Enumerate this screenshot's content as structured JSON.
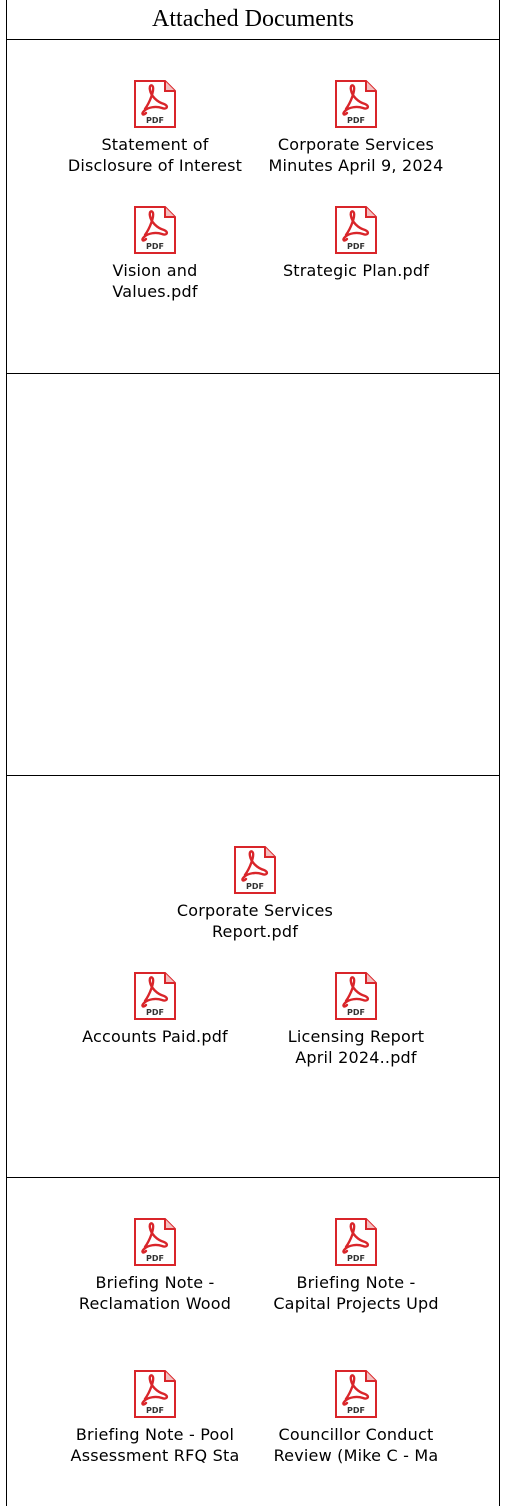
{
  "header": {
    "title": "Attached Documents"
  },
  "sections": [
    {
      "documents": [
        {
          "name": "Statement of\nDisclosure of Interest",
          "icon": "pdf-icon"
        },
        {
          "name": "Corporate Services\nMinutes April 9, 2024",
          "icon": "pdf-icon"
        },
        {
          "name": "Vision and\nValues.pdf",
          "icon": "pdf-icon"
        },
        {
          "name": "Strategic Plan.pdf",
          "icon": "pdf-icon"
        }
      ]
    },
    {
      "documents": []
    },
    {
      "documents": [
        {
          "name": "Corporate Services\nReport.pdf",
          "icon": "pdf-icon"
        },
        {
          "name": "Accounts Paid.pdf",
          "icon": "pdf-icon"
        },
        {
          "name": "Licensing Report\nApril 2024..pdf",
          "icon": "pdf-icon"
        }
      ]
    },
    {
      "documents": [
        {
          "name": "Briefing Note -\nReclamation Wood",
          "icon": "pdf-icon"
        },
        {
          "name": "Briefing Note -\nCapital Projects Upd",
          "icon": "pdf-icon"
        },
        {
          "name": "Briefing Note - Pool\nAssessment RFQ Sta",
          "icon": "pdf-icon"
        },
        {
          "name": "Councillor Conduct\nReview (Mike C - Ma",
          "icon": "pdf-icon"
        }
      ]
    }
  ],
  "colors": {
    "pdf_red": "#d9252a",
    "border": "#000000"
  }
}
